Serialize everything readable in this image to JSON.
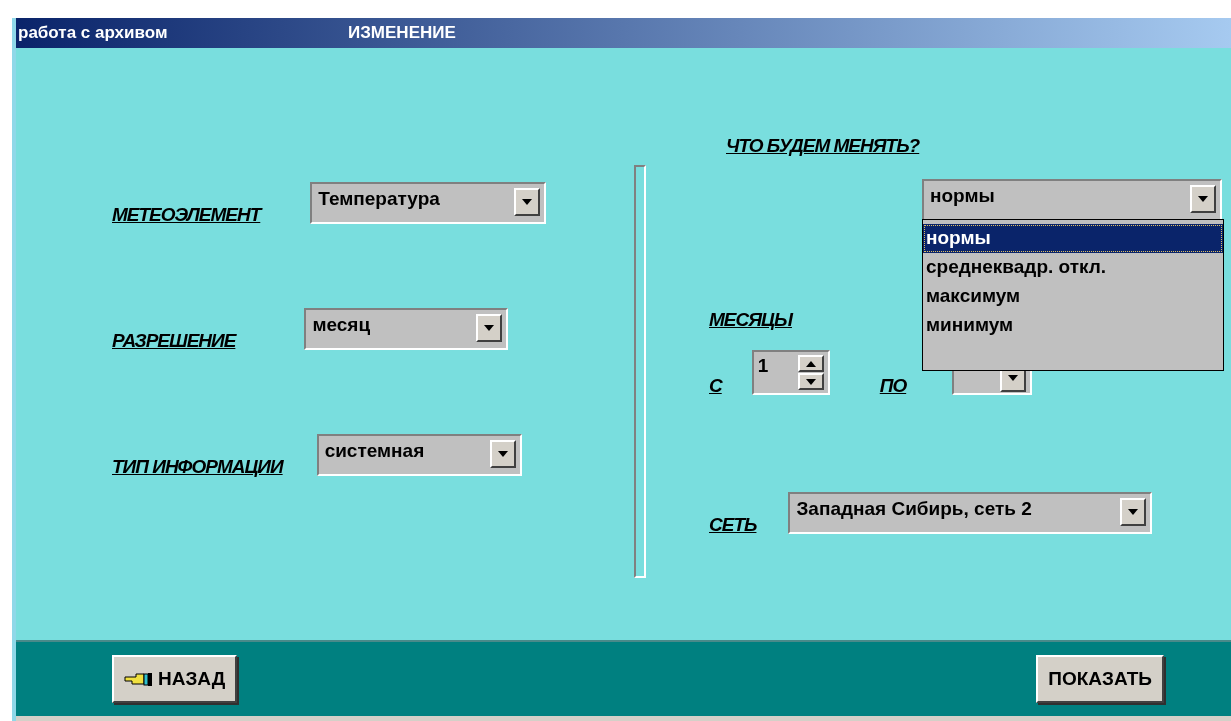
{
  "window": {
    "title": "работа с архивом",
    "subtitle": "ИЗМЕНЕНИЕ"
  },
  "left_fields": [
    {
      "label": "МЕТЕОЭЛЕМЕНТ",
      "value": "Температура"
    },
    {
      "label": "РАЗРЕШЕНИЕ",
      "value": "месяц"
    },
    {
      "label": "ТИП ИНФОРМАЦИИ",
      "value": "системная"
    }
  ],
  "change": {
    "label": "ЧТО БУДЕМ МЕНЯТЬ?",
    "value": "нормы",
    "expanded": true,
    "options": [
      {
        "label": "нормы",
        "selected": true
      },
      {
        "label": "среднеквадр. откл.",
        "selected": false
      },
      {
        "label": "максимум",
        "selected": false
      },
      {
        "label": "минимум",
        "selected": false
      }
    ]
  },
  "months": {
    "label": "МЕСЯЦЫ",
    "from_label": "С",
    "from_value": "1",
    "to_label": "ПО"
  },
  "network": {
    "label": "СЕТЬ",
    "value": "Западная Сибирь, сеть 2"
  },
  "buttons": [
    {
      "label": "НАЗАД",
      "kind": "back"
    },
    {
      "label": "ПОКАЗАТЬ",
      "kind": "plain"
    }
  ]
}
